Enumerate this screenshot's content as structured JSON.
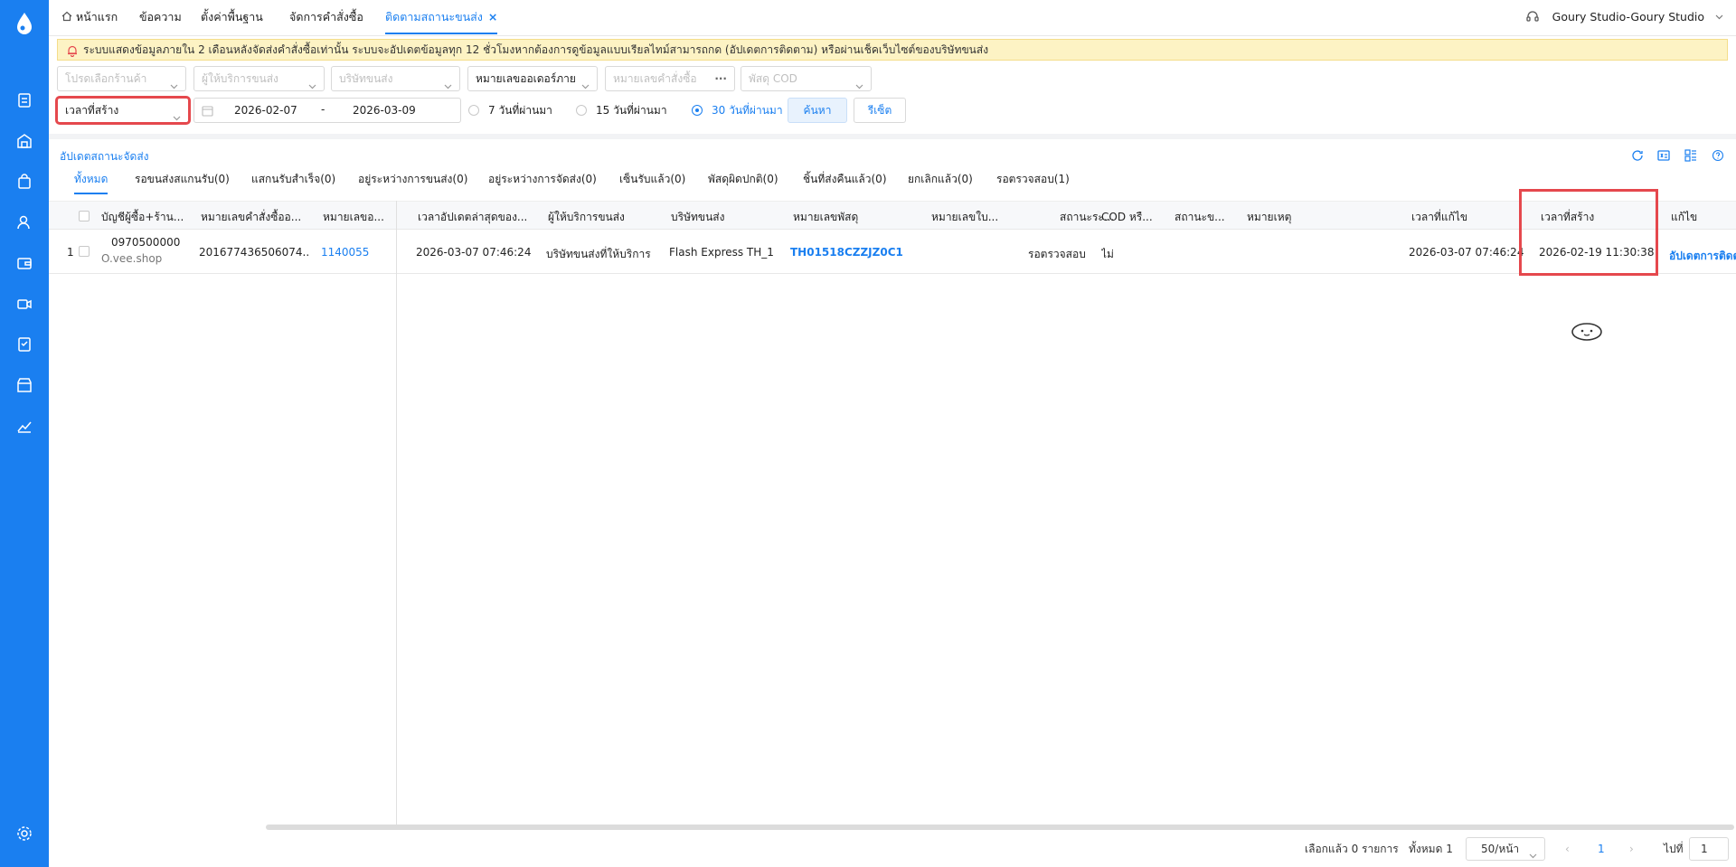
{
  "tabs": [
    {
      "label": "หน้าแรก"
    },
    {
      "label": "ข้อความ"
    },
    {
      "label": "ตั้งค่าพื้นฐาน"
    },
    {
      "label": "จัดการคำสั่งซื้อ"
    },
    {
      "label": "ติดตามสถานะขนส่ง",
      "active": true,
      "close": "×"
    }
  ],
  "user": "Goury Studio-Goury Studio",
  "notice": "ระบบแสดงข้อมูลภายใน 2 เดือนหลังจัดส่งคำสั่งซื้อเท่านั้น ระบบจะอัปเดตข้อมูลทุก 12 ชั่วโมงหากต้องการดูข้อมูลแบบเรียลไทม์สามารถกด (อัปเดตการติดตาม) หรือผ่านเช็คเว็บไซต์ของบริษัทขนส่ง",
  "filters": {
    "store_placeholder": "โปรดเลือกร้านค้า",
    "provider_placeholder": "ผู้ให้บริการขนส่ง",
    "carrier_placeholder": "บริษัทขนส่ง",
    "order_type_value": "หมายเลขออเดอร์ภาย",
    "order_no_placeholder": "หมายเลขคำสั่งซื้อ",
    "order_no_dots": "···",
    "cod_placeholder": "พัสดุ COD",
    "time_type_value": "เวลาที่สร้าง",
    "date_start": "2026-02-07",
    "date_sep": "-",
    "date_end": "2026-03-09",
    "radio_7": "7 วันที่ผ่านมา",
    "radio_15": "15 วันที่ผ่านมา",
    "radio_30": "30 วันที่ผ่านมา",
    "search_label": "ค้นหา",
    "reset_label": "รีเซ็ต"
  },
  "update_status_label": "อัปเดตสถานะจัดส่ง",
  "status_tabs": [
    "ทั้งหมด",
    "รอขนส่งสแกนรับ(0)",
    "แสกนรับสำเร็จ(0)",
    "อยู่ระหว่างการขนส่ง(0)",
    "อยู่ระหว่างการจัดส่ง(0)",
    "เซ็นรับแล้ว(0)",
    "พัสดุผิดปกติ(0)",
    "ชิ้นที่ส่งคืนแล้ว(0)",
    "ยกเลิกแล้ว(0)",
    "รอตรวจสอบ(1)"
  ],
  "table": {
    "headers": {
      "buyer": "บัญชีผู้ซื้อ+ร้าน...",
      "order_no": "หมายเลขคำสั่งซื้ออ...",
      "internal_no": "หมายเลขอ...",
      "last_update": "เวลาอัปเดตล่าสุดของ...",
      "provider": "ผู้ให้บริการขนส่ง",
      "carrier": "บริษัทขนส่ง",
      "parcel_no": "หมายเลขพัสดุ",
      "bill_no": "หมายเลขใบ...",
      "status": "สถานะระ...",
      "cod": "COD หรื...",
      "ship_status": "สถานะข...",
      "note": "หมายเหตุ",
      "modified_time": "เวลาที่แก้ไข",
      "created_time": "เวลาที่สร้าง",
      "edit": "แก้ไข"
    },
    "rows": [
      {
        "index": "1",
        "buyer_phone": "0970500000",
        "buyer_shop": "O.vee.shop",
        "order_no": "201677436506074...",
        "internal_no": "1140055",
        "last_update": "2026-03-07 07:46:24",
        "provider": "บริษัทขนส่งที่ให้บริการ",
        "carrier": "Flash Express TH_1",
        "parcel_no": "TH01518CZZJZ0C1",
        "status": "รอตรวจสอบ",
        "cod": "ไม่",
        "modified_time": "2026-03-07 07:46:24",
        "created_time": "2026-02-19 11:30:38",
        "edit_action": "อัปเดตการติดต"
      }
    ]
  },
  "pagination": {
    "selected": "เลือกแล้ว 0 รายการ",
    "total": "ทั้งหมด 1",
    "page_size": "50/หน้า",
    "current_page": "1",
    "goto_label": "ไปที่",
    "goto_value": "1"
  },
  "colors": {
    "accent": "#1a7ff0",
    "highlight": "#e5484d",
    "notice_bg": "#fdf3c4"
  }
}
